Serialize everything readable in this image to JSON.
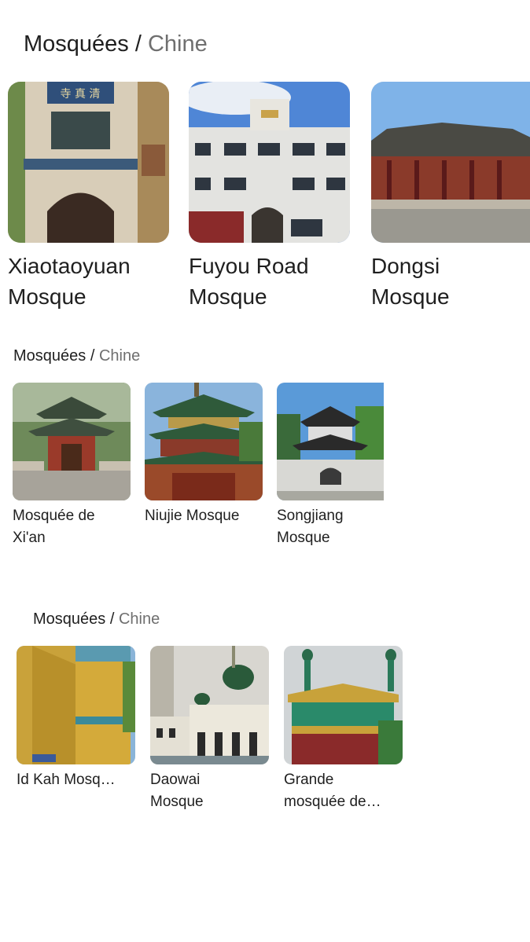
{
  "sections": [
    {
      "category": "Mosquées",
      "separator": " / ",
      "location": "Chine",
      "items": [
        {
          "line1": "Xiaotaoyuan",
          "line2": "Mosque",
          "image": "xiaotaoyuan-mosque-photo"
        },
        {
          "line1": "Fuyou Road",
          "line2": "Mosque",
          "image": "fuyou-road-mosque-photo"
        },
        {
          "line1": "Dongsi",
          "line2": "Mosque",
          "image": "dongsi-mosque-photo"
        }
      ]
    },
    {
      "category": "Mosquées",
      "separator": " / ",
      "location": "Chine",
      "items": [
        {
          "line1": "Mosquée de",
          "line2": "Xi'an",
          "image": "xian-mosque-photo"
        },
        {
          "line1": "Niujie Mosque",
          "line2": "",
          "image": "niujie-mosque-photo"
        },
        {
          "line1": "Songjiang",
          "line2": "Mosque",
          "image": "songjiang-mosque-photo"
        }
      ]
    },
    {
      "category": "Mosquées",
      "separator": " / ",
      "location": "Chine",
      "items": [
        {
          "line1": "Id Kah Mosq…",
          "line2": "",
          "image": "id-kah-mosque-photo"
        },
        {
          "line1": "Daowai",
          "line2": "Mosque",
          "image": "daowai-mosque-photo"
        },
        {
          "line1": "Grande",
          "line2": "mosquée de…",
          "image": "grande-mosquee-photo"
        }
      ]
    }
  ]
}
